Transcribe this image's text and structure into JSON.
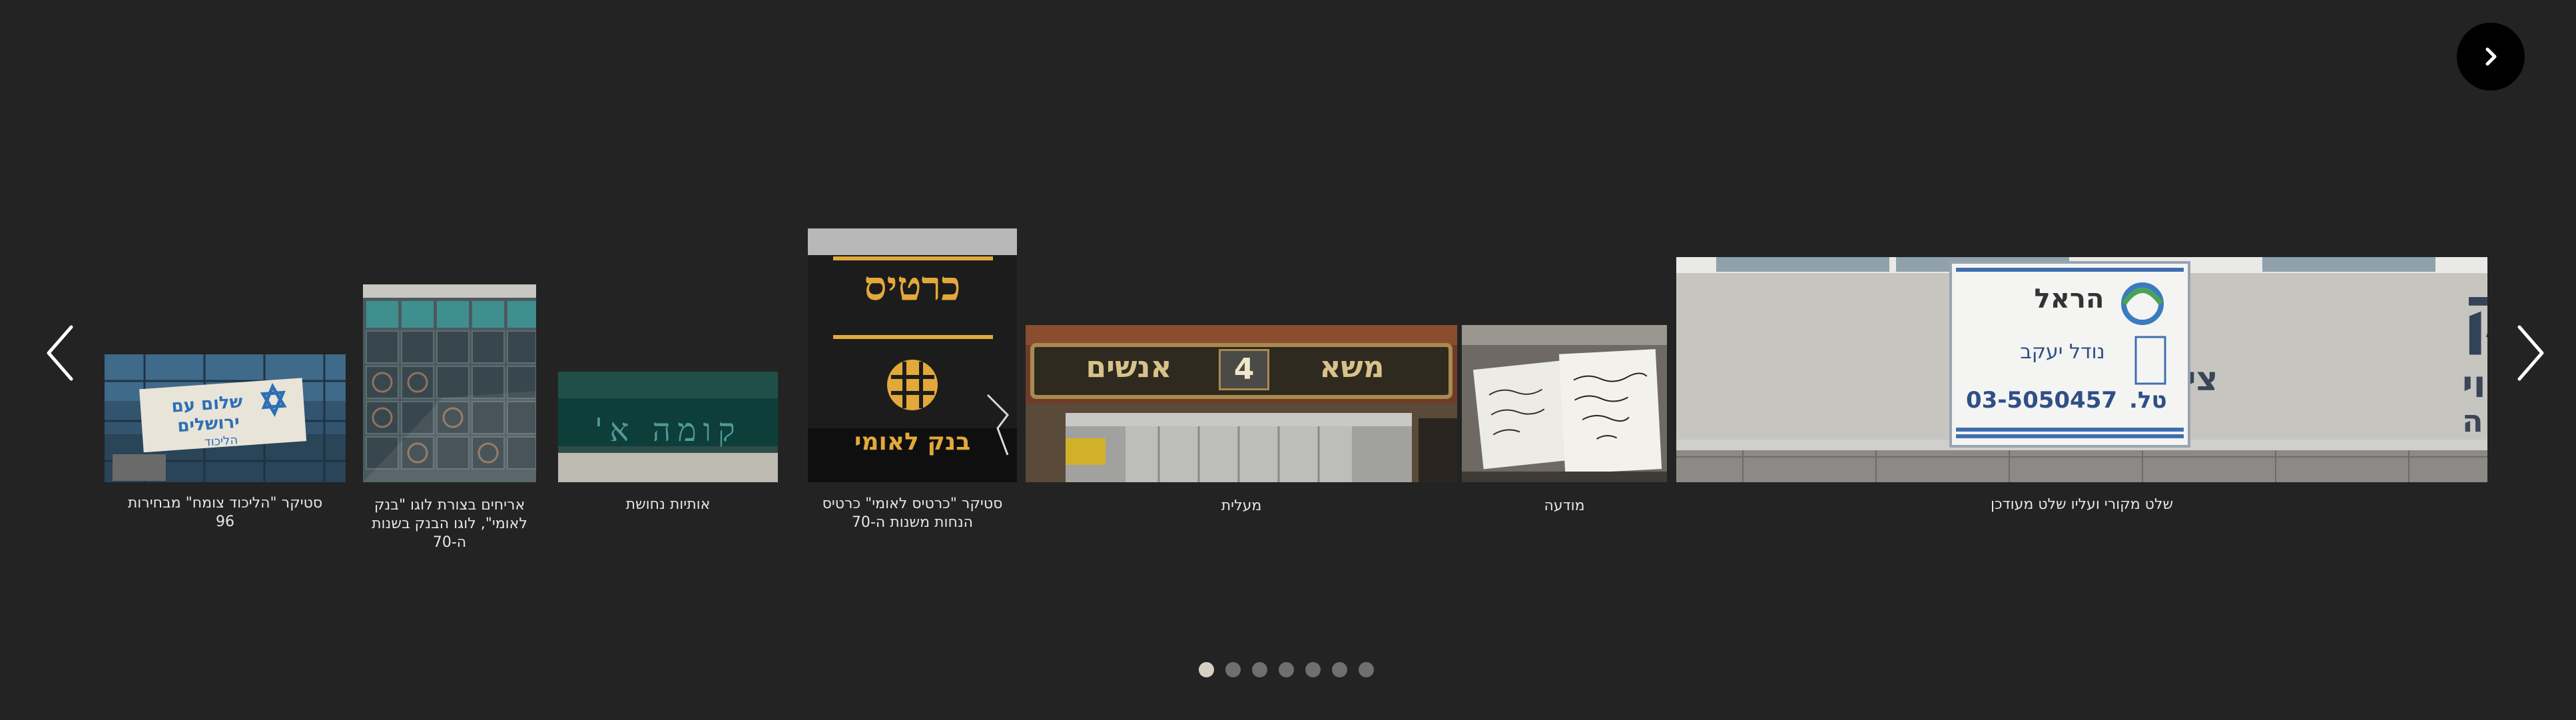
{
  "carousel": {
    "items": [
      {
        "caption": "סטיקר \"הליכוד צומח\" מבחירות 96",
        "sticker_text": "שלום עם ירושלים",
        "sticker_sub": "הליכוד"
      },
      {
        "caption": "אריחים בצורת לוגו \"בנק לאומי\", לוגו הבנק בשנות ה-70"
      },
      {
        "caption": "אותיות נחושת",
        "sign_text": "קומה א'"
      },
      {
        "caption": "סטיקר \"כרטיס לאומי\" כרטיס הנחות משנות ה-70",
        "top_text": "כרטיס",
        "bottom_text": "בנק לאומי"
      },
      {
        "caption": "מעלית",
        "plate_left": "משא",
        "plate_number": "4",
        "plate_right": "אנשים"
      },
      {
        "caption": "מודעה"
      },
      {
        "caption": "שלט מקורי ועליו שלט מעודכן",
        "sign_center_title": "הראל",
        "sign_center_line2": "נודל יעקב",
        "sign_center_phone": "03-5050457",
        "sign_center_tel": "טל."
      }
    ],
    "dots_count": 7,
    "active_dot": 0
  },
  "icons": {
    "next_round": "chevron-right-icon",
    "prev": "chevron-left-icon",
    "next": "chevron-right-icon"
  }
}
